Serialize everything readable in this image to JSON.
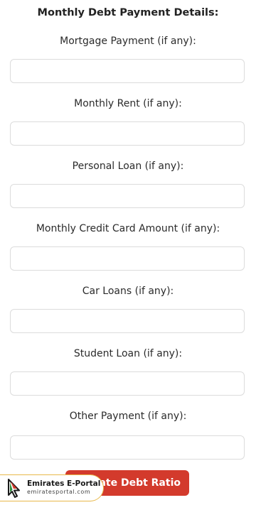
{
  "section_title": "Monthly Debt Payment Details:",
  "fields": [
    {
      "label": "Mortgage Payment (if any):",
      "value": "",
      "placeholder": ""
    },
    {
      "label": "Monthly Rent (if any):",
      "value": "",
      "placeholder": ""
    },
    {
      "label": "Personal Loan (if any):",
      "value": "",
      "placeholder": ""
    },
    {
      "label": "Monthly Credit Card Amount (if any):",
      "value": "",
      "placeholder": ""
    },
    {
      "label": "Car Loans (if any):",
      "value": "",
      "placeholder": ""
    },
    {
      "label": "Student Loan (if any):",
      "value": "",
      "placeholder": ""
    },
    {
      "label": "Other Payment (if any):",
      "value": "",
      "placeholder": ""
    }
  ],
  "button": {
    "label": "late Debt Ratio",
    "color": "#d33a2c"
  },
  "watermark": {
    "title": "Emirates E-Portal",
    "url": "emiratesportal.com",
    "icon": "cursor-pointer-icon",
    "border_color": "#e8b84a"
  }
}
